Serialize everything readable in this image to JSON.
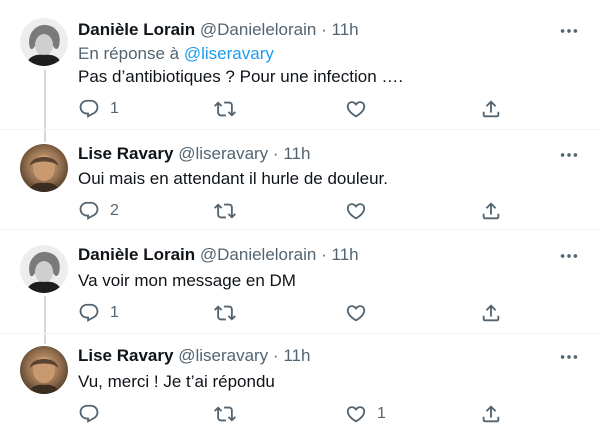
{
  "tweets": [
    {
      "name": "Danièle Lorain",
      "handle": "@Danielelorain",
      "dot": "·",
      "time": "11h",
      "reply_prefix": "En réponse à",
      "reply_mention": "@liseravary",
      "text": "Pas d’antibiotiques ? Pour une infection ….",
      "reply_count": "1",
      "retweet_count": "",
      "like_count": ""
    },
    {
      "name": "Lise Ravary",
      "handle": "@liseravary",
      "dot": "·",
      "time": "11h",
      "text": "Oui mais en attendant il hurle de douleur.",
      "reply_count": "2",
      "retweet_count": "",
      "like_count": ""
    },
    {
      "name": "Danièle Lorain",
      "handle": "@Danielelorain",
      "dot": "·",
      "time": "11h",
      "text": "Va voir mon message en DM",
      "reply_count": "1",
      "retweet_count": "",
      "like_count": ""
    },
    {
      "name": "Lise Ravary",
      "handle": "@liseravary",
      "dot": "·",
      "time": "11h",
      "text": "Vu, merci ! Je t’ai répondu",
      "reply_count": "",
      "retweet_count": "",
      "like_count": "1"
    }
  ],
  "icons": {
    "reply": "reply-icon",
    "retweet": "retweet-icon",
    "like": "heart-icon",
    "share": "share-icon",
    "more": "more-icon"
  },
  "colors": {
    "text": "#0f1419",
    "secondary": "#536471",
    "link": "#1d9bf0",
    "thread_line": "#cfd9de"
  }
}
